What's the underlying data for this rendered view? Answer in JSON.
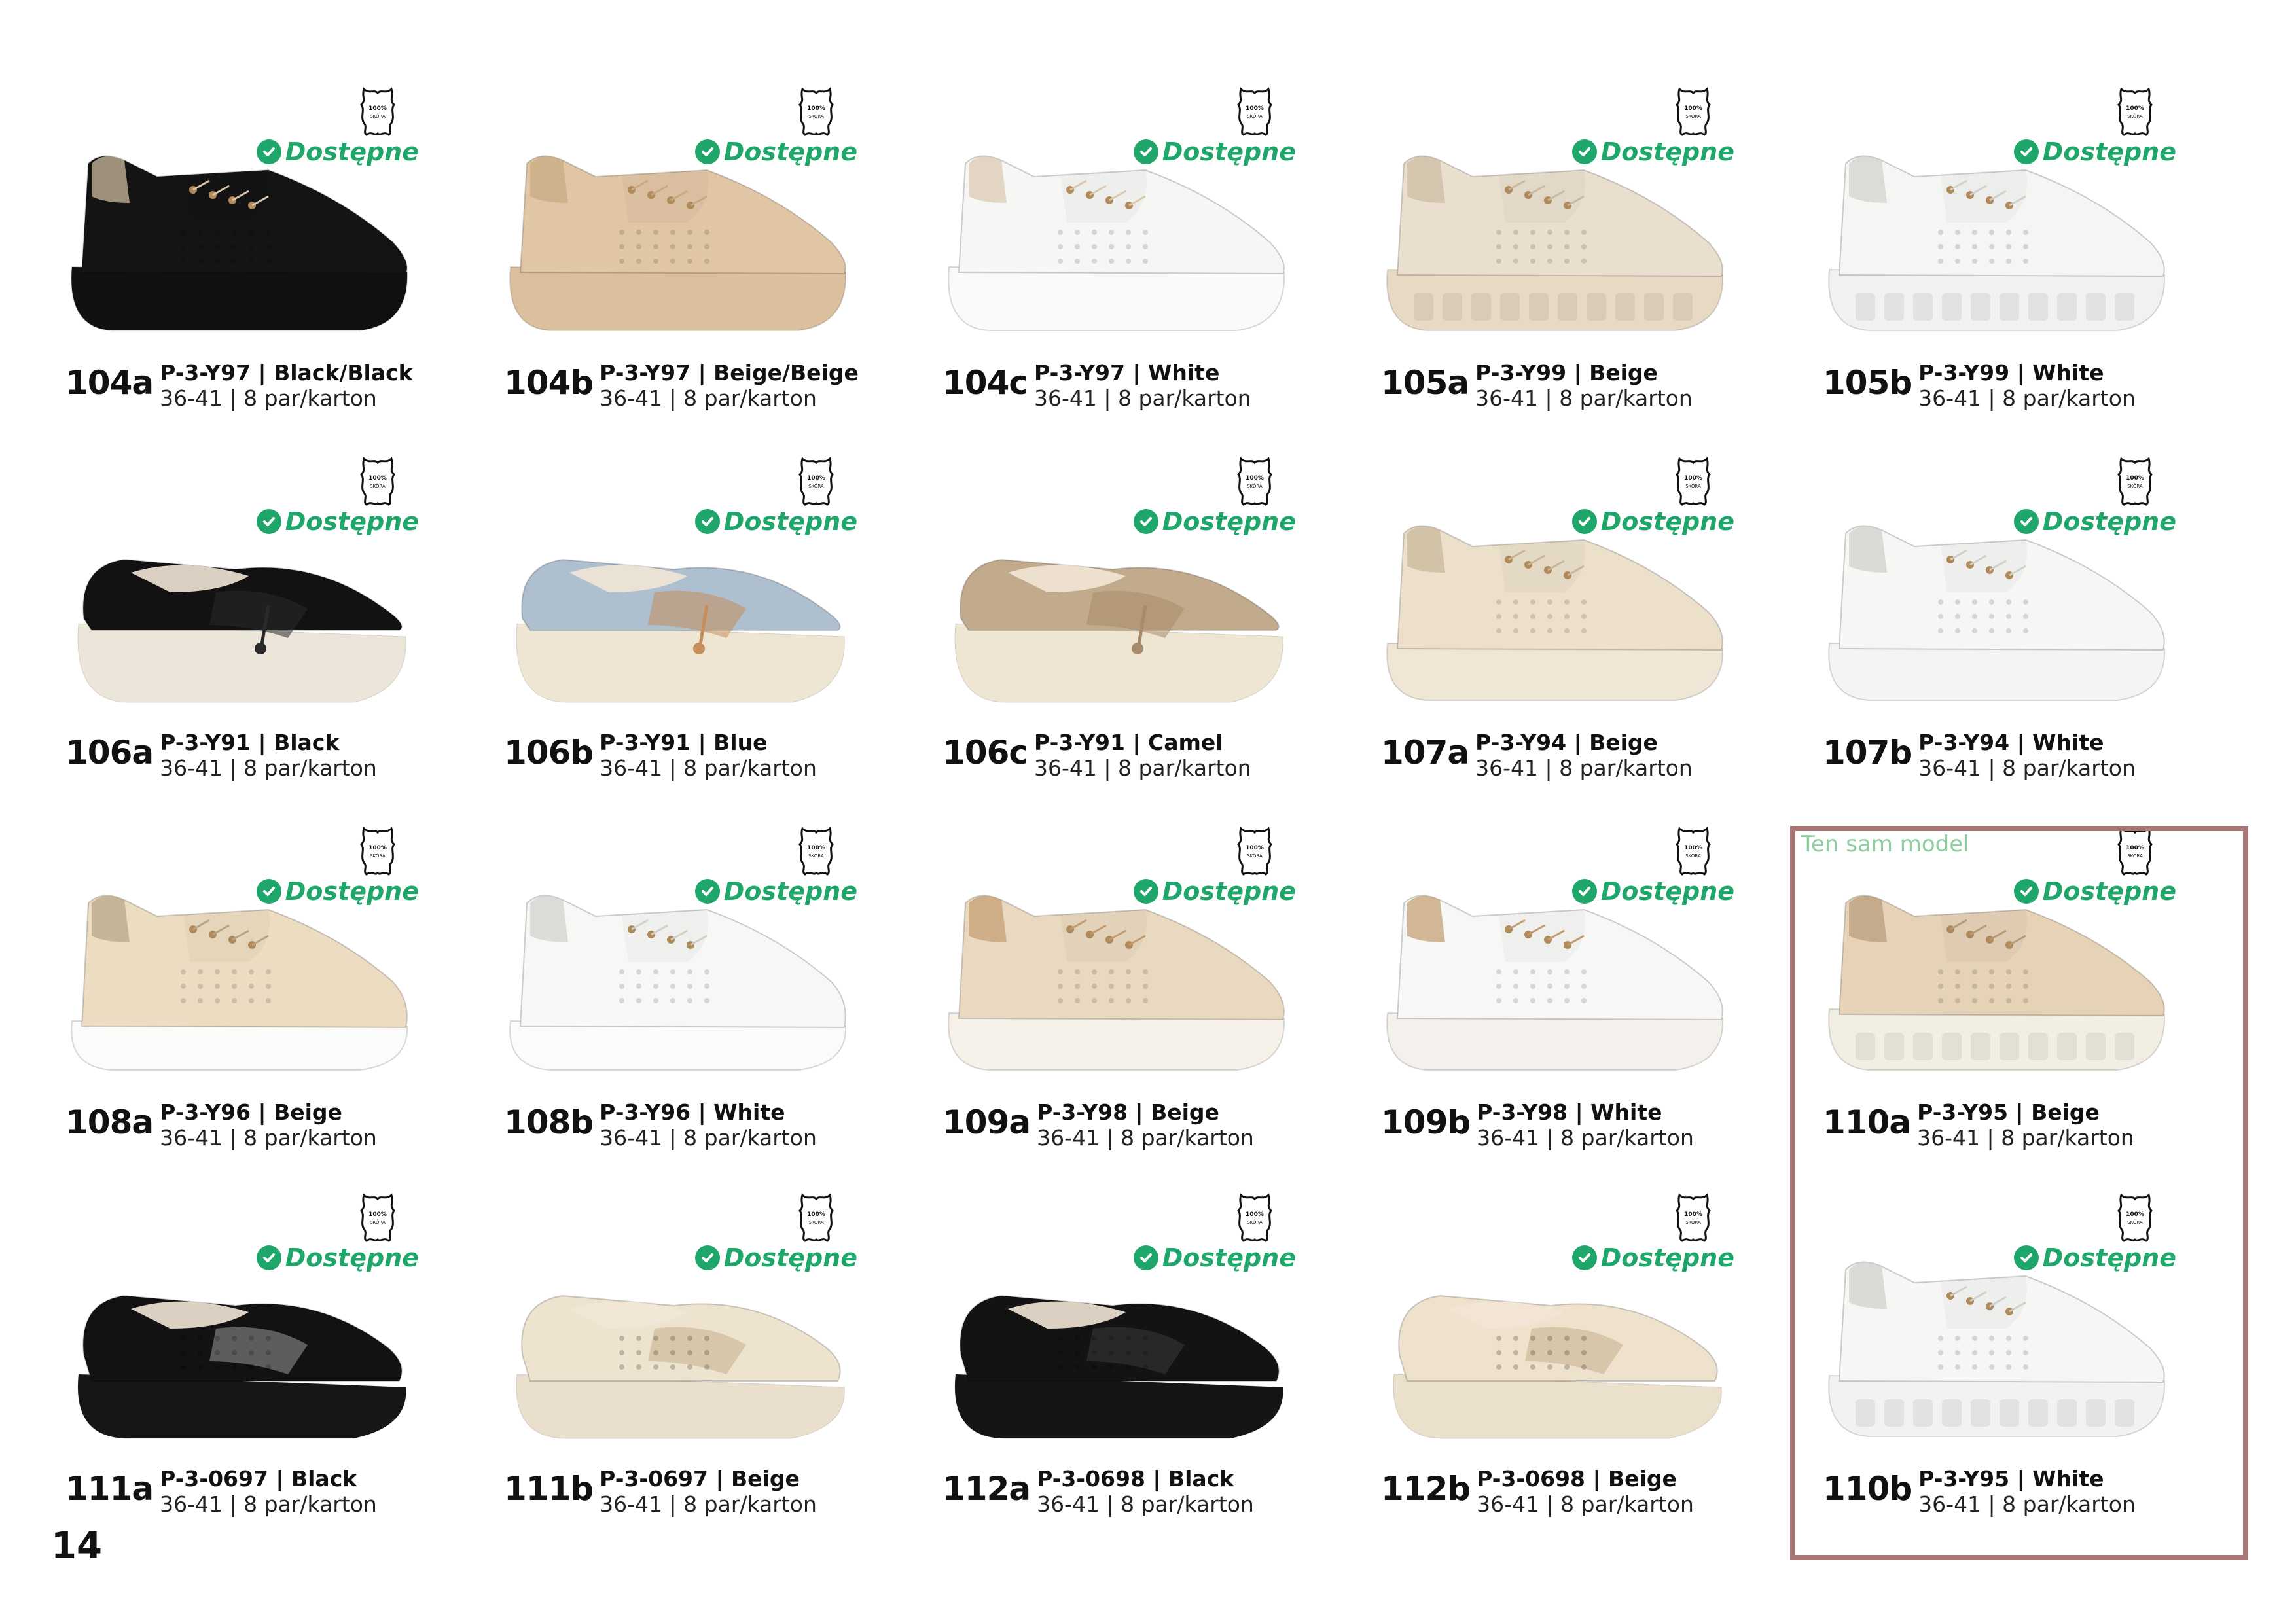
{
  "page_number": "14",
  "availability_label": "Dostępne",
  "leather_badge": {
    "line1": "100%",
    "line2": "SKÓRA",
    "icon": "leather-hide-icon"
  },
  "group_frame": {
    "label": "Ten sam model",
    "color": "#a97676"
  },
  "colors": {
    "available": "#1fa66a",
    "frame": "#a97676",
    "frame_label": "#8fcf9f"
  },
  "products": [
    {
      "id": "104a",
      "code": "P-3-Y97 | Black/Black",
      "sizes": "36-41 | 8 par/karton",
      "shoe": "sneaker-platform",
      "upper": "#141414",
      "sole": "#111111",
      "accent": "#d8c6a8"
    },
    {
      "id": "104b",
      "code": "P-3-Y97 | Beige/Beige",
      "sizes": "36-41 | 8 par/karton",
      "shoe": "sneaker-platform",
      "upper": "#e1c6a6",
      "sole": "#dcbf9d",
      "accent": "#c8a982"
    },
    {
      "id": "104c",
      "code": "P-3-Y97 | White",
      "sizes": "36-41 | 8 par/karton",
      "shoe": "sneaker-platform",
      "upper": "#f6f6f4",
      "sole": "#fafafa",
      "accent": "#dac8ae"
    },
    {
      "id": "105a",
      "code": "P-3-Y99 | Beige",
      "sizes": "36-41 | 8 par/karton",
      "shoe": "sneaker-lug",
      "upper": "#eadfcf",
      "sole": "#e7d9c4",
      "accent": "#c9b99f"
    },
    {
      "id": "105b",
      "code": "P-3-Y99 | White",
      "sizes": "36-41 | 8 par/karton",
      "shoe": "sneaker-lug",
      "upper": "#f5f5f3",
      "sole": "#f1f1ef",
      "accent": "#d0d0cc"
    },
    {
      "id": "106a",
      "code": "P-3-Y91 | Black",
      "sizes": "36-41 | 8 par/karton",
      "shoe": "loafer",
      "upper": "#121212",
      "sole": "#ece6da",
      "accent": "#2a2a2a"
    },
    {
      "id": "106b",
      "code": "P-3-Y91 | Blue",
      "sizes": "36-41 | 8 par/karton",
      "shoe": "loafer",
      "upper": "#aebfcf",
      "sole": "#eee6d2",
      "accent": "#c58e5b"
    },
    {
      "id": "106c",
      "code": "P-3-Y91 | Camel",
      "sizes": "36-41 | 8 par/karton",
      "shoe": "loafer",
      "upper": "#c2ab8c",
      "sole": "#eee6d2",
      "accent": "#a88a68"
    },
    {
      "id": "107a",
      "code": "P-3-Y94 | Beige",
      "sizes": "36-41 | 8 par/karton",
      "shoe": "sneaker-wedge",
      "upper": "#ece0cb",
      "sole": "#efe6d6",
      "accent": "#c8b597"
    },
    {
      "id": "107b",
      "code": "P-3-Y94 | White",
      "sizes": "36-41 | 8 par/karton",
      "shoe": "sneaker-wedge",
      "upper": "#f6f6f4",
      "sole": "#f4f4f2",
      "accent": "#cfcfcb"
    },
    {
      "id": "108a",
      "code": "P-3-Y96 | Beige",
      "sizes": "36-41 | 8 par/karton",
      "shoe": "sneaker-low",
      "upper": "#ecdcc2",
      "sole": "#fbfbf9",
      "accent": "#b7a283"
    },
    {
      "id": "108b",
      "code": "P-3-Y96 | White",
      "sizes": "36-41 | 8 par/karton",
      "shoe": "sneaker-low",
      "upper": "#f7f7f5",
      "sole": "#fbfbfb",
      "accent": "#cfcfcb"
    },
    {
      "id": "109a",
      "code": "P-3-Y98 | Beige",
      "sizes": "36-41 | 8 par/karton",
      "shoe": "sneaker-wedge",
      "upper": "#ead9c1",
      "sole": "#f6f2ea",
      "accent": "#c29b6d"
    },
    {
      "id": "109b",
      "code": "P-3-Y98 | White",
      "sizes": "36-41 | 8 par/karton",
      "shoe": "sneaker-wedge",
      "upper": "#f7f7f5",
      "sole": "#f4f1ec",
      "accent": "#c29b6d"
    },
    {
      "id": "110a",
      "code": "P-3-Y95 | Beige",
      "sizes": "36-41 | 8 par/karton",
      "shoe": "sneaker-lug",
      "upper": "#e6d2b7",
      "sole": "#f3eee4",
      "accent": "#b59a78"
    },
    {
      "id": "111a",
      "code": "P-3-0697 | Black",
      "sizes": "36-41 | 8 par/karton",
      "shoe": "moccasin",
      "upper": "#121212",
      "sole": "#161616",
      "accent": "#9a9a9a"
    },
    {
      "id": "111b",
      "code": "P-3-0697 | Beige",
      "sizes": "36-41 | 8 par/karton",
      "shoe": "moccasin",
      "upper": "#eee3cf",
      "sole": "#eadfcd",
      "accent": "#c4ae8c"
    },
    {
      "id": "112a",
      "code": "P-3-0698 | Black",
      "sizes": "36-41 | 8 par/karton",
      "shoe": "moccasin",
      "upper": "#131313",
      "sole": "#151515",
      "accent": "#3a3a3a"
    },
    {
      "id": "112b",
      "code": "P-3-0698 | Beige",
      "sizes": "36-41 | 8 par/karton",
      "shoe": "moccasin",
      "upper": "#eee2cd",
      "sole": "#ebe0cc",
      "accent": "#c4ae8c"
    },
    {
      "id": "110b",
      "code": "P-3-Y95 | White",
      "sizes": "36-41 | 8 par/karton",
      "shoe": "sneaker-lug",
      "upper": "#f6f6f4",
      "sole": "#f2f2f0",
      "accent": "#cfcfcb"
    }
  ]
}
